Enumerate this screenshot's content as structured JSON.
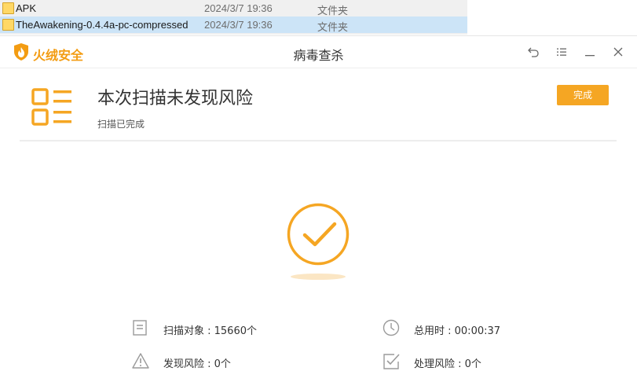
{
  "explorer": {
    "rows": [
      {
        "name": "APK",
        "date": "2024/3/7 19:36",
        "type": "文件夹"
      },
      {
        "name": "TheAwakening-0.4.4a-pc-compressed",
        "date": "2024/3/7 19:36",
        "type": "文件夹"
      }
    ]
  },
  "app": {
    "brand": "火绒安全",
    "title": "病毒查杀",
    "icons": {
      "brand": "flame-shield-icon",
      "back": "back-icon",
      "menu": "menu-icon",
      "minimize": "minimize-icon",
      "close": "close-icon"
    }
  },
  "result": {
    "headline": "本次扫描未发现风险",
    "status": "扫描已完成",
    "done_button": "完成",
    "accent_color": "#f5a623"
  },
  "stats": {
    "scanned": "扫描对象 : 15660个",
    "duration": "总用时 : 00:00:37",
    "risks_found": "发现风险 : 0个",
    "risks_handled": "处理风险 : 0个"
  }
}
